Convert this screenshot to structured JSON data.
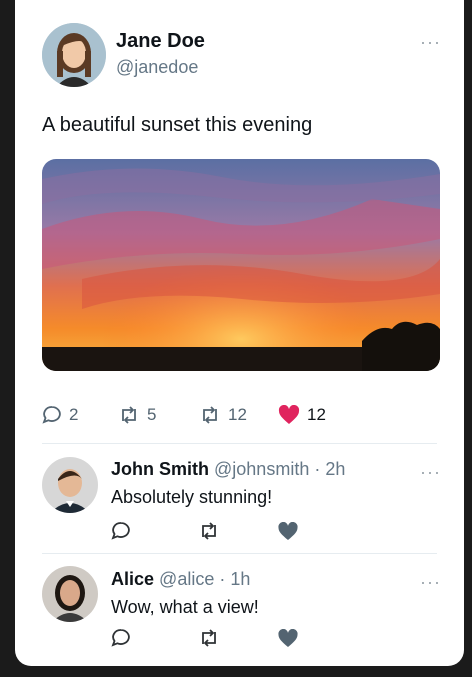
{
  "post": {
    "author_name": "Jane Doe",
    "author_handle": "@janedoe",
    "text": "A beautiful sunset this evening",
    "image_alt": "sunset-photo",
    "stats": {
      "replies": "2",
      "reposts_a": "5",
      "reposts_b": "12",
      "likes": "12"
    },
    "more_label": "···"
  },
  "comments": [
    {
      "name": "John Smith",
      "handle": "@johnsmith",
      "time": "· 2h",
      "text": "Absolutely stunning!"
    },
    {
      "name": "Alice",
      "handle": "@alice",
      "time": "· 1h",
      "text": "Wow, what a view!"
    }
  ],
  "colors": {
    "like_active": "#e0245e",
    "icon_gray": "#536471",
    "comment_icon": "#2f3336"
  }
}
